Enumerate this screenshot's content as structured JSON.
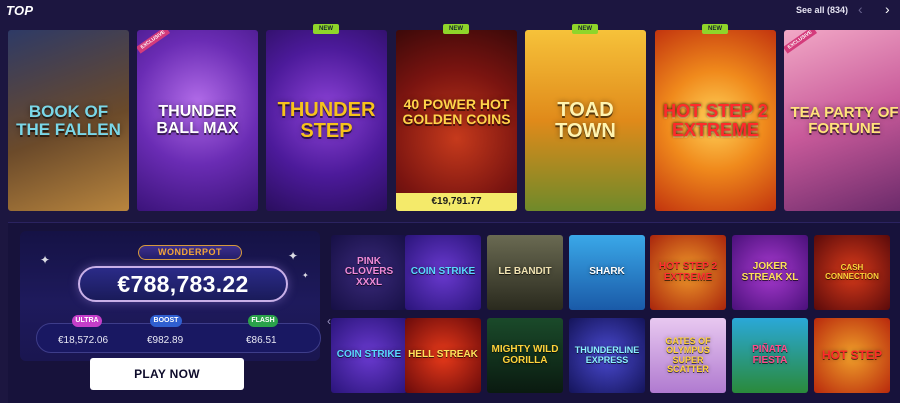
{
  "section": {
    "title": "TOP",
    "see_all_label": "See all (834)",
    "prev_icon": "‹",
    "next_icon": "›"
  },
  "top_games": [
    {
      "title": "Book of the Fallen",
      "badge": ""
    },
    {
      "title": "Thunder Ball Max",
      "badge": "EXCLUSIVE"
    },
    {
      "title": "Thunder Step",
      "badge": "NEW"
    },
    {
      "title": "40 Power Hot Golden Coins",
      "badge": "NEW",
      "jackpot": "€19,791.77"
    },
    {
      "title": "Toad Town",
      "badge": "NEW"
    },
    {
      "title": "Hot Step 2 Extreme",
      "badge": "NEW"
    },
    {
      "title": "Tea Party of Fortune",
      "badge": "EXCLUSIVE"
    }
  ],
  "wonderpot": {
    "label": "WONDERPOT",
    "amount": "€788,783.22",
    "tiers": [
      {
        "name": "ULTRA",
        "value": "€18,572.06",
        "color": "#c43ec9"
      },
      {
        "name": "BOOST",
        "value": "€982.89",
        "color": "#2f5fd0"
      },
      {
        "name": "FLASH",
        "value": "€86.51",
        "color": "#2aa24a"
      }
    ],
    "play_label": "PLAY NOW"
  },
  "grid_nav": {
    "prev_icon": "‹",
    "next_icon": "›"
  },
  "grid_games": [
    {
      "title": "Pink Clovers XXXL"
    },
    {
      "title": "Coin Strike"
    },
    {
      "title": "Le Bandit"
    },
    {
      "title": "Shark"
    },
    {
      "title": "Hot Step 2 Extreme"
    },
    {
      "title": "Joker Streak XL"
    },
    {
      "title": "Cash Connection"
    },
    {
      "title": "Coin Strike"
    },
    {
      "title": "Hell Streak"
    },
    {
      "title": "Mighty Wild Gorilla"
    },
    {
      "title": "Thunderline Express"
    },
    {
      "title": "Gates of Olympus Super Scatter"
    },
    {
      "title": "Piñata Fiesta"
    },
    {
      "title": "Hot Step"
    }
  ]
}
